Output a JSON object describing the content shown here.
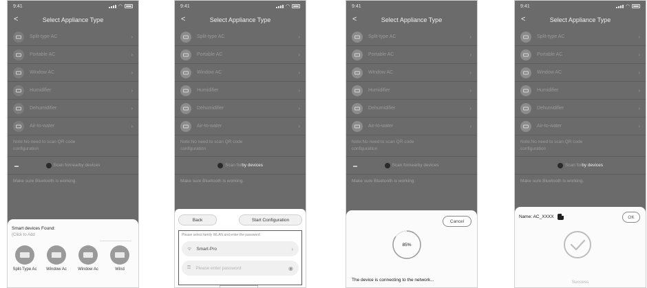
{
  "status": {
    "time": "9:41"
  },
  "nav": {
    "back": "<",
    "title": "Select Appliance Type"
  },
  "appliances": [
    {
      "label": "Split-type AC",
      "icon": "split-ac-icon"
    },
    {
      "label": "Portable AC",
      "icon": "portable-ac-icon"
    },
    {
      "label": "Window AC",
      "icon": "window-ac-icon"
    },
    {
      "label": "Humidifier",
      "icon": "humidifier-icon"
    },
    {
      "label": "Dehumidifier",
      "icon": "dehumidifier-icon"
    },
    {
      "label": "Air-to-water",
      "icon": "air-to-water-icon"
    }
  ],
  "note": {
    "text": "Note:No need to scan QR code",
    "suffix": "configuration"
  },
  "scan": {
    "prefix": "Scan for ",
    "nearby": "nearby devices",
    "nearby_short": "by devices"
  },
  "bluetooth": "Make sure Bluetooth is working.",
  "phone1": {
    "found_title": "Smart devices Found:",
    "click_hint": "(Click to Add",
    "devices": [
      "Split-Type Ac",
      "Window Ac",
      "Window Ac",
      "Wind"
    ]
  },
  "phone2": {
    "back": "Back",
    "start": "Start Configuration",
    "hint": "Please select family WLAN and enter the password",
    "wifi_name": "Smart-Pro",
    "password_placeholder": "Please enter password"
  },
  "phone3": {
    "cancel": "Cancel",
    "progress_text": "85%",
    "progress": 0.85,
    "connecting": "The device is connecting to the network..."
  },
  "phone4": {
    "name_label": "Name: AC_XXXX",
    "ok": "OK",
    "success": "Success"
  },
  "colors": {
    "overlay": "#6b6b6b",
    "sheet": "#fbfbfb"
  }
}
